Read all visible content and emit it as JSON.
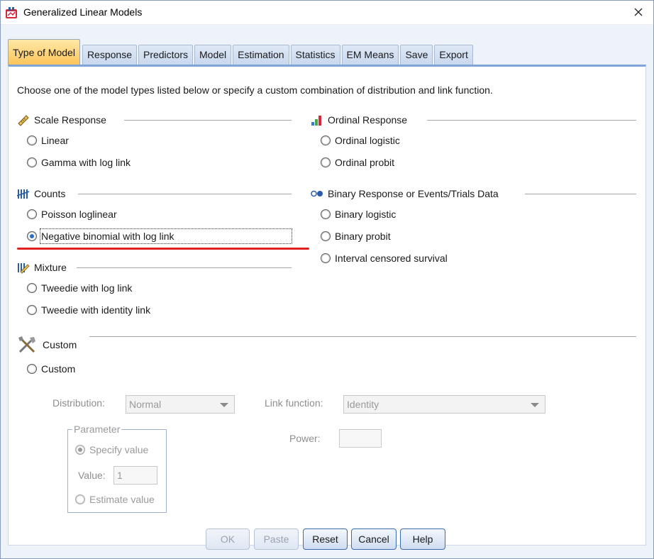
{
  "window": {
    "title": "Generalized Linear Models"
  },
  "tabs": [
    {
      "label": "Type of Model",
      "active": true
    },
    {
      "label": "Response"
    },
    {
      "label": "Predictors"
    },
    {
      "label": "Model"
    },
    {
      "label": "Estimation"
    },
    {
      "label": "Statistics"
    },
    {
      "label": "EM Means"
    },
    {
      "label": "Save"
    },
    {
      "label": "Export"
    }
  ],
  "instruction": "Choose one of the model types listed below or specify a custom combination of distribution and link function.",
  "groups": {
    "scale": {
      "title": "Scale Response",
      "options": [
        "Linear",
        "Gamma with log link"
      ]
    },
    "ordinal": {
      "title": "Ordinal Response",
      "options": [
        "Ordinal logistic",
        "Ordinal probit"
      ]
    },
    "counts": {
      "title": "Counts",
      "options": [
        "Poisson loglinear",
        "Negative binomial with log link"
      ]
    },
    "binary": {
      "title": "Binary Response or Events/Trials Data",
      "options": [
        "Binary logistic",
        "Binary probit",
        "Interval censored survival"
      ]
    },
    "mixture": {
      "title": "Mixture",
      "options": [
        "Tweedie with log link",
        "Tweedie with identity link"
      ]
    },
    "custom": {
      "title": "Custom",
      "options": [
        "Custom"
      ]
    }
  },
  "selected_option": "Negative binomial with log link",
  "custom_settings": {
    "distribution_label": "Distribution:",
    "distribution_value": "Normal",
    "link_label": "Link function:",
    "link_value": "Identity",
    "parameter_title": "Parameter",
    "specify_value": "Specify value",
    "value_label": "Value:",
    "value": "1",
    "estimate_value": "Estimate value",
    "power_label": "Power:",
    "power_value": ""
  },
  "buttons": {
    "ok": "OK",
    "paste": "Paste",
    "reset": "Reset",
    "cancel": "Cancel",
    "help": "Help"
  },
  "colors": {
    "active_tab": "#fcc45a",
    "panel_border": "#7ea4d8",
    "annotation": "#e02020"
  },
  "icons": {
    "app": "glm-app-icon",
    "scale": "ruler-icon",
    "ordinal": "bar-steps-icon",
    "counts": "tally-icon",
    "binary": "binary-dots-icon",
    "mixture": "mixture-icon",
    "custom": "tools-icon"
  }
}
